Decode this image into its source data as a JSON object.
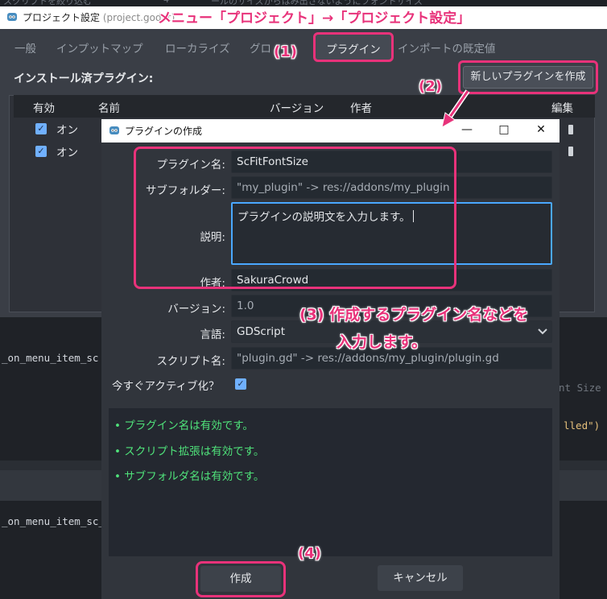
{
  "top_strip": {
    "left": "スクリプトを絞り込む",
    "num": "4",
    "right": "ールのサイズからはみ出さないようにフォントサイズ"
  },
  "project_settings": {
    "title": "プロジェクト設定",
    "title_file": "(project.godot)",
    "tabs": [
      "一般",
      "インプットマップ",
      "ローカライズ",
      "グロ",
      "プラグイン",
      "インポートの既定値"
    ],
    "installed_label": "インストール済プラグイン:",
    "new_plugin_button": "新しいプラグインを作成",
    "columns": [
      "有効",
      "名前",
      "バージョン",
      "作者",
      "編集"
    ],
    "rows": [
      {
        "enabled": true,
        "state": "オン"
      },
      {
        "enabled": true,
        "state": "オン"
      }
    ]
  },
  "background_editor": {
    "line1": "_on_menu_item_sc",
    "line2": "_on_menu_item_sc_",
    "right1": "nt Size",
    "right2": "lled\")"
  },
  "dialog": {
    "title": "プラグインの作成",
    "controls": {
      "minimize": "—",
      "maximize": "□",
      "close": "✕"
    },
    "fields": {
      "plugin_name_label": "プラグイン名:",
      "plugin_name_value": "ScFitFontSize",
      "subfolder_label": "サブフォルダー:",
      "subfolder_placeholder": "\"my_plugin\" -> res://addons/my_plugin",
      "description_label": "説明:",
      "description_value": "プラグインの説明文を入力します。",
      "author_label": "作者:",
      "author_value": "SakuraCrowd",
      "version_label": "バージョン:",
      "version_placeholder": "1.0",
      "language_label": "言語:",
      "language_value": "GDScript",
      "script_name_label": "スクリプト名:",
      "script_name_placeholder": "\"plugin.gd\" -> res://addons/my_plugin/plugin.gd",
      "activate_label": "今すぐアクティブ化？",
      "activate_checked": true
    },
    "status_messages": [
      "• プラグイン名は有効です。",
      "• スクリプト拡張は有効です。",
      "• サブフォルダ名は有効です。"
    ],
    "create_button": "作成",
    "cancel_button": "キャンセル"
  },
  "annotations": {
    "header": "メニュー「プロジェクト」→「プロジェクト設定」",
    "step1": "(1)",
    "step2": "(2)",
    "step3_line1": "(3) 作成するプラグイン名などを",
    "step3_line2": "入力します。",
    "step4": "(4)"
  },
  "colors": {
    "accent": "#e8327a",
    "status_ok": "#4fe27a",
    "focus": "#4aa8ff",
    "checkbox": "#70b0ff"
  }
}
